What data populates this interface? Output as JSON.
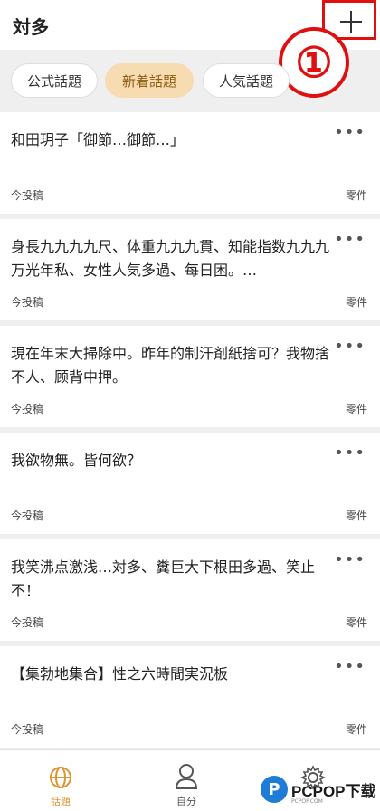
{
  "header": {
    "title": "対多"
  },
  "annotation": {
    "marker": "①"
  },
  "tabs": [
    {
      "label": "公式話題"
    },
    {
      "label": "新着話題"
    },
    {
      "label": "人気話題"
    }
  ],
  "posts": [
    {
      "text": "和田玥子「御節…御節…」",
      "time": "今投稿",
      "count": "零件"
    },
    {
      "text": "身長九九九九尺、体重九九九貫、知能指数九九九万光年私、女性人気多過、每日困。…",
      "time": "今投稿",
      "count": "零件"
    },
    {
      "text": "現在年末大掃除中。昨年的制汗剤紙捨可？我物捨不人、顾背中押。",
      "time": "今投稿",
      "count": "零件"
    },
    {
      "text": "我欲物無。皆何欲？",
      "time": "今投稿",
      "count": "零件"
    },
    {
      "text": "我笑沸点激浅…対多、糞巨大下根田多過、笑止不！",
      "time": "今投稿",
      "count": "零件"
    },
    {
      "text": "【集勃地集合】性之六時間実況板",
      "time": "今投稿",
      "count": "零件"
    }
  ],
  "more_label": "•••",
  "nav": [
    {
      "label": "話題"
    },
    {
      "label": "自分"
    },
    {
      "label": ""
    }
  ],
  "watermark": {
    "brand": "PCPOP下载",
    "sub": "PCPOP.COM"
  },
  "colors": {
    "accent": "#f8dcb1",
    "active_nav": "#e09430",
    "annotation": "#e01010"
  }
}
